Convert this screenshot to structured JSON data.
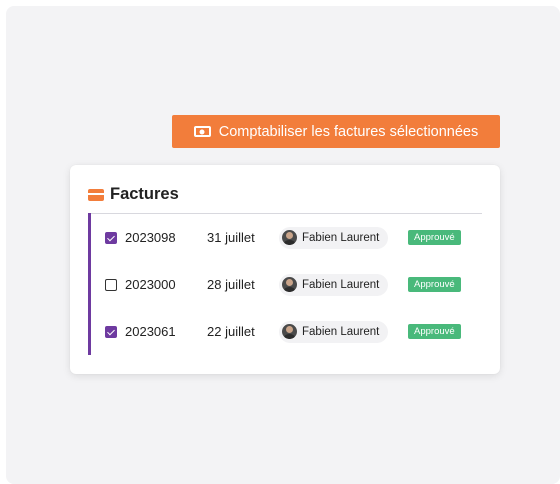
{
  "toolbar": {
    "post_button_label": "Comptabiliser les factures sélectionnées",
    "post_button_icon": "cash-icon",
    "accent_color": "#f27d3b"
  },
  "invoices_card": {
    "title": "Factures",
    "title_icon": "credit-card-icon",
    "selection_color": "#6e3aa0",
    "rows": [
      {
        "number": "2023098",
        "date": "31 juillet",
        "assignee": "Fabien Laurent",
        "status": "Approuvé",
        "selected": true
      },
      {
        "number": "2023000",
        "date": "28 juillet",
        "assignee": "Fabien Laurent",
        "status": "Approuvé",
        "selected": false
      },
      {
        "number": "2023061",
        "date": "22 juillet",
        "assignee": "Fabien Laurent",
        "status": "Approuvé",
        "selected": true
      }
    ],
    "status_color": "#49b97b"
  }
}
